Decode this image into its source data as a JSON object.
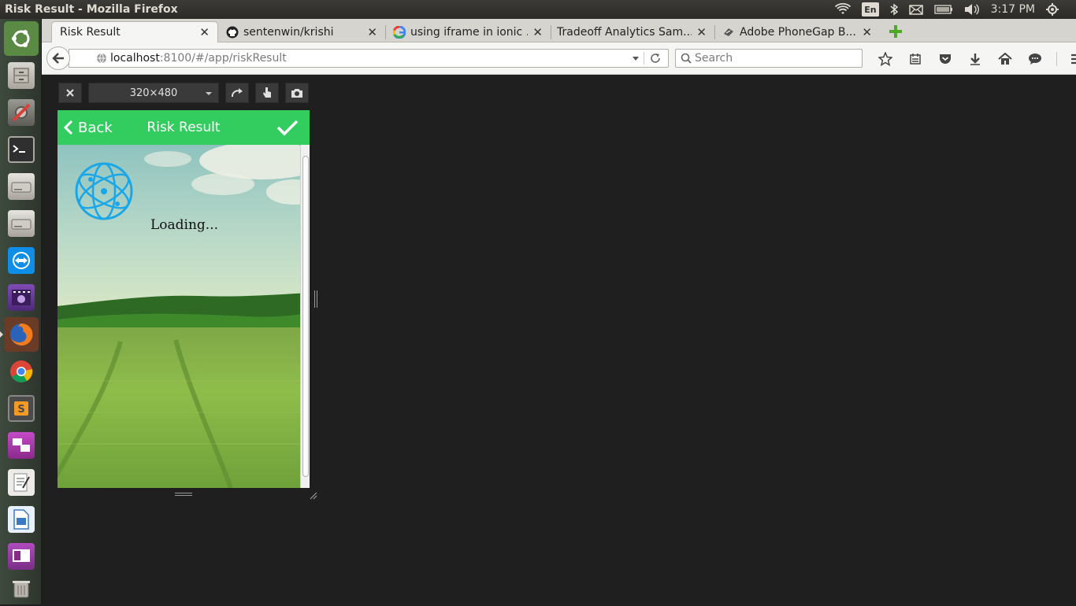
{
  "system": {
    "window_title": "Risk Result - Mozilla Firefox",
    "keyboard_layout": "En",
    "clock": "3:17 PM"
  },
  "launcher": {
    "items": [
      "ubuntu-dash",
      "file-manager",
      "system-settings",
      "terminal",
      "drive-1",
      "drive-2",
      "teamviewer",
      "video-player",
      "firefox",
      "chrome",
      "sublime-text",
      "remote-desktop",
      "text-editor",
      "libreoffice-writer",
      "libreoffice-impress",
      "trash"
    ]
  },
  "browser": {
    "tabs": [
      {
        "label": "Risk Result",
        "icon": "none",
        "active": true
      },
      {
        "label": "sentenwin/krishi",
        "icon": "github-icon",
        "active": false
      },
      {
        "label": "using iframe in ionic ...",
        "icon": "google-icon",
        "active": false
      },
      {
        "label": "Tradeoff Analytics Sam...",
        "icon": "none",
        "active": false
      },
      {
        "label": "Adobe PhoneGap B...",
        "icon": "phonegap-icon",
        "active": false
      }
    ],
    "url_host": "localhost",
    "url_rest": ":8100/#/app/riskResult",
    "search_placeholder": "Search"
  },
  "responsive": {
    "size_label": "320×480"
  },
  "app": {
    "header": {
      "back_label": "Back",
      "title": "Risk Result"
    },
    "loading_text": "Loading..."
  },
  "colors": {
    "header_green": "#33cd5f",
    "logo_blue": "#1aa7e8"
  }
}
